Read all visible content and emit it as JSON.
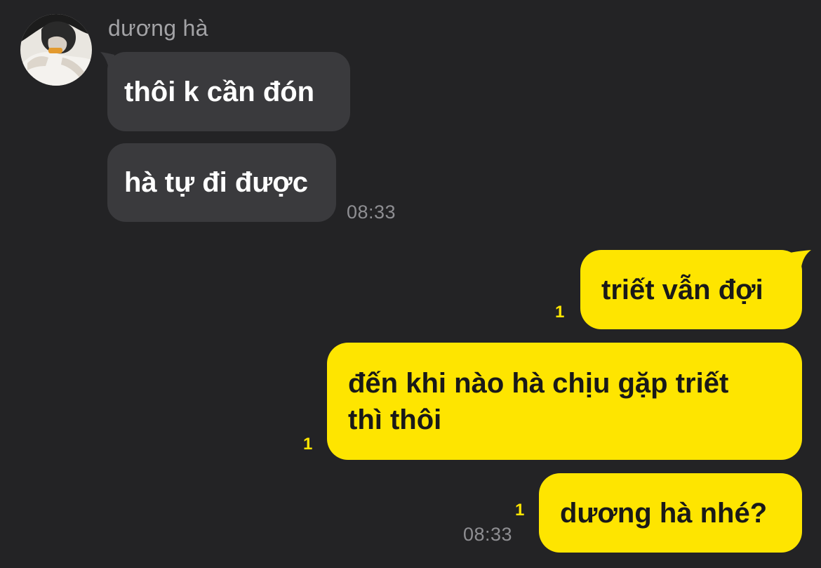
{
  "sender": {
    "name": "dương hà",
    "avatar_icon": "profile-photo"
  },
  "incoming_messages": [
    {
      "text": "thôi k cần đón"
    },
    {
      "text": "hà tự đi được"
    }
  ],
  "incoming_time": "08:33",
  "outgoing_messages": [
    {
      "text": "triết vẫn đợi",
      "unread": "1"
    },
    {
      "line1": "đến khi nào hà chịu gặp triết",
      "line2": "thì thôi",
      "unread": "1"
    },
    {
      "text": "dương hà nhé?",
      "unread": "1"
    }
  ],
  "outgoing_time": "08:33",
  "colors": {
    "background": "#232325",
    "incoming_bubble": "#3a3a3d",
    "outgoing_bubble": "#fee500",
    "unread_count": "#fee500"
  }
}
